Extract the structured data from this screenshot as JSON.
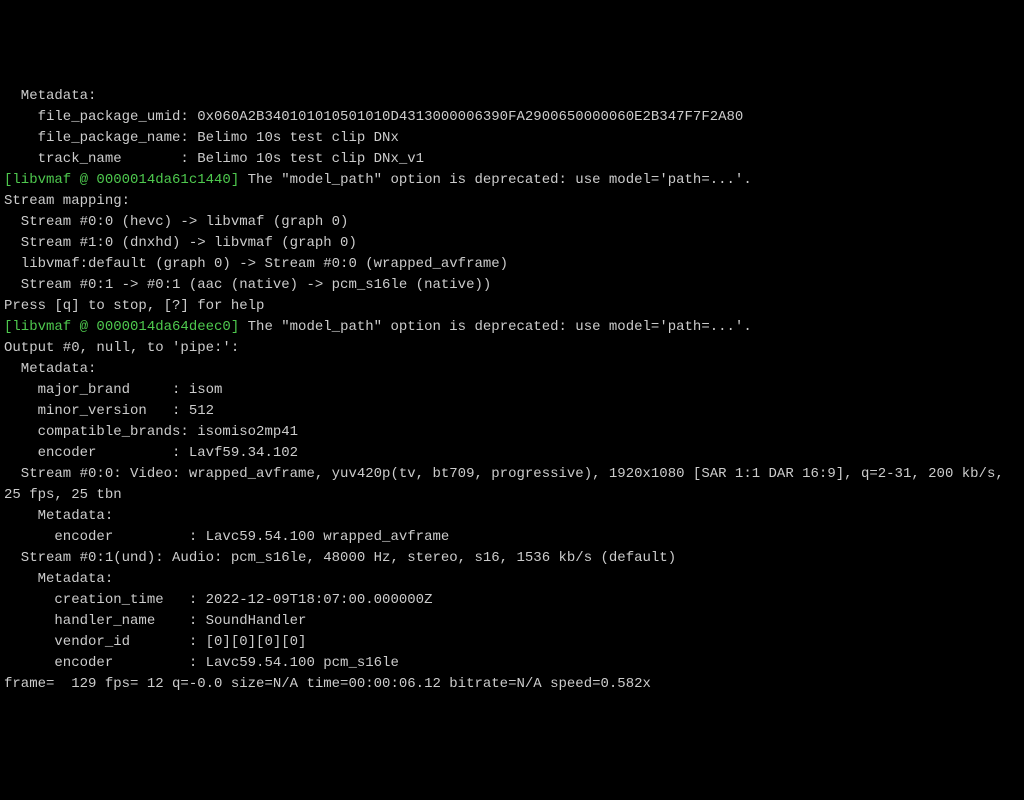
{
  "lines": [
    {
      "indent": "  ",
      "text": "Metadata:"
    },
    {
      "indent": "    ",
      "text": "file_package_umid: 0x060A2B340101010501010D4313000006390FA2900650000060E2B347F7F2A80"
    },
    {
      "indent": "    ",
      "text": "file_package_name: Belimo 10s test clip DNx"
    },
    {
      "indent": "    ",
      "text": "track_name       : Belimo 10s test clip DNx_v1"
    },
    {
      "type": "mixed",
      "green": "[libvmaf @ 0000014da61c1440]",
      "text": " The \"model_path\" option is deprecated: use model='path=...'."
    },
    {
      "indent": "",
      "text": "Stream mapping:"
    },
    {
      "indent": "  ",
      "text": "Stream #0:0 (hevc) -> libvmaf (graph 0)"
    },
    {
      "indent": "  ",
      "text": "Stream #1:0 (dnxhd) -> libvmaf (graph 0)"
    },
    {
      "indent": "  ",
      "text": "libvmaf:default (graph 0) -> Stream #0:0 (wrapped_avframe)"
    },
    {
      "indent": "  ",
      "text": "Stream #0:1 -> #0:1 (aac (native) -> pcm_s16le (native))"
    },
    {
      "indent": "",
      "text": "Press [q] to stop, [?] for help"
    },
    {
      "type": "mixed",
      "green": "[libvmaf @ 0000014da64deec0]",
      "text": " The \"model_path\" option is deprecated: use model='path=...'."
    },
    {
      "indent": "",
      "text": "Output #0, null, to 'pipe:':"
    },
    {
      "indent": "  ",
      "text": "Metadata:"
    },
    {
      "indent": "    ",
      "text": "major_brand     : isom"
    },
    {
      "indent": "    ",
      "text": "minor_version   : 512"
    },
    {
      "indent": "    ",
      "text": "compatible_brands: isomiso2mp41"
    },
    {
      "indent": "    ",
      "text": "encoder         : Lavf59.34.102"
    },
    {
      "indent": "  ",
      "text": "Stream #0:0: Video: wrapped_avframe, yuv420p(tv, bt709, progressive), 1920x1080 [SAR 1:1 DAR 16:9], q=2-31, 200 kb/s,"
    },
    {
      "indent": "",
      "text": "25 fps, 25 tbn"
    },
    {
      "indent": "    ",
      "text": "Metadata:"
    },
    {
      "indent": "      ",
      "text": "encoder         : Lavc59.54.100 wrapped_avframe"
    },
    {
      "indent": "  ",
      "text": "Stream #0:1(und): Audio: pcm_s16le, 48000 Hz, stereo, s16, 1536 kb/s (default)"
    },
    {
      "indent": "    ",
      "text": "Metadata:"
    },
    {
      "indent": "      ",
      "text": "creation_time   : 2022-12-09T18:07:00.000000Z"
    },
    {
      "indent": "      ",
      "text": "handler_name    : SoundHandler"
    },
    {
      "indent": "      ",
      "text": "vendor_id       : [0][0][0][0]"
    },
    {
      "indent": "      ",
      "text": "encoder         : Lavc59.54.100 pcm_s16le"
    },
    {
      "indent": "",
      "text": "frame=  129 fps= 12 q=-0.0 size=N/A time=00:00:06.12 bitrate=N/A speed=0.582x"
    }
  ]
}
